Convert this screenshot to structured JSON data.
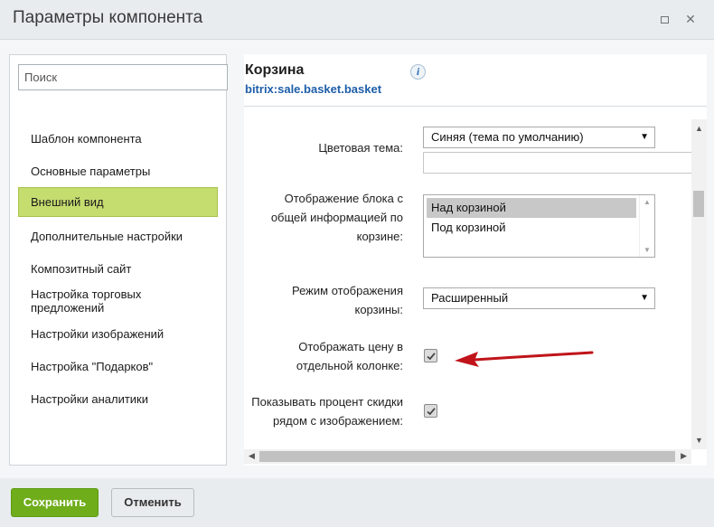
{
  "window": {
    "title": "Параметры компонента"
  },
  "sidebar": {
    "search_placeholder": "Поиск",
    "items": [
      {
        "label": "Шаблон компонента",
        "active": false
      },
      {
        "label": "Основные параметры",
        "active": false
      },
      {
        "label": "Внешний вид",
        "active": true
      },
      {
        "label": "Дополнительные настройки",
        "active": false
      },
      {
        "label": "Композитный сайт",
        "active": false
      },
      {
        "label": "Настройка торговых предложений",
        "active": false
      },
      {
        "label": "Настройки изображений",
        "active": false
      },
      {
        "label": "Настройка \"Подарков\"",
        "active": false
      },
      {
        "label": "Настройки аналитики",
        "active": false
      }
    ]
  },
  "component": {
    "title": "Корзина",
    "code": "bitrix:sale.basket.basket",
    "info_icon": "info-icon"
  },
  "form": {
    "color_theme": {
      "label": "Цветовая тема:",
      "value": "Синяя (тема по умолчанию)",
      "custom_value": ""
    },
    "info_block": {
      "label": "Отображение блока с общей информацией по корзине:",
      "options": [
        {
          "label": "Над корзиной",
          "selected": true
        },
        {
          "label": "Под корзиной",
          "selected": false
        }
      ]
    },
    "display_mode": {
      "label": "Режим отображения корзины:",
      "value": "Расширенный"
    },
    "price_column": {
      "label": "Отображать цену в отдельной колонке:",
      "checked": true
    },
    "discount_near_image": {
      "label": "Показывать процент скидки рядом с изображением:",
      "checked": true
    }
  },
  "annotation": {
    "color": "#c0141a"
  },
  "footer": {
    "save_label": "Сохранить",
    "cancel_label": "Отменить"
  },
  "colors": {
    "active_item": "#c5dc6f",
    "save_button": "#6fad1b",
    "link": "#1e5ea8"
  }
}
